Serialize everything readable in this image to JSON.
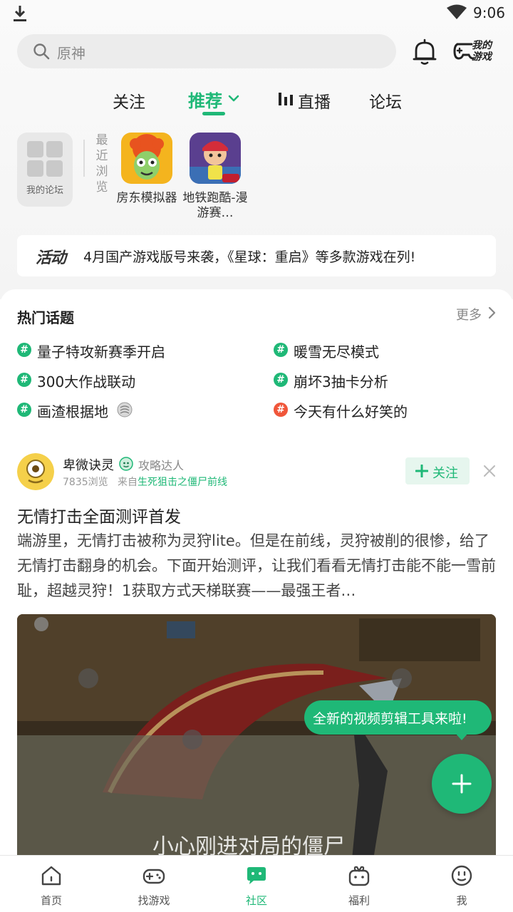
{
  "status_bar": {
    "time": "9:06"
  },
  "header": {
    "search_placeholder": "原神",
    "my_games_label": "我的游戏"
  },
  "tabs": [
    {
      "label": "关注"
    },
    {
      "label": "推荐"
    },
    {
      "label": "直播"
    },
    {
      "label": "论坛"
    }
  ],
  "recent": {
    "my_forum_label": "我的论坛",
    "recent_label": "最近浏览",
    "games": [
      {
        "name": "房东模拟器"
      },
      {
        "name": "地铁跑酷-漫游赛…"
      }
    ]
  },
  "activity": {
    "tag": "活动",
    "text": "4月国产游戏版号来袭，《星球：重启》等多款游戏在列!"
  },
  "hot_topics": {
    "title": "热门话题",
    "more_label": "更多",
    "items": [
      {
        "text": "量子特攻新赛季开启",
        "hot": false
      },
      {
        "text": "暖雪无尽模式",
        "hot": false
      },
      {
        "text": "300大作战联动",
        "hot": false
      },
      {
        "text": "崩坏3抽卡分析",
        "hot": false
      },
      {
        "text": "画渣根据地",
        "hot": false
      },
      {
        "text": "今天有什么好笑的",
        "hot": true
      }
    ]
  },
  "post": {
    "author": "卑微诀灵",
    "author_title": "攻略达人",
    "views": "7835浏览",
    "source_prefix": "来自",
    "source": "生死狙击之僵尸前线",
    "follow_label": "关注",
    "title": "无情打击全面测评首发",
    "body": "端游里，无情打击被称为灵狩lite。但是在前线，灵狩被削的很惨，给了无情打击翻身的机会。下面开始测评，让我们看看无情打击能不能一雪前耻，超越灵狩！1获取方式天梯联赛——最强王者…",
    "image_caption": "小心刚进对局的僵尸"
  },
  "tooltip": {
    "text": "全新的视频剪辑工具来啦!"
  },
  "bottom_nav": [
    {
      "label": "首页"
    },
    {
      "label": "找游戏"
    },
    {
      "label": "社区"
    },
    {
      "label": "福利"
    },
    {
      "label": "我"
    }
  ],
  "colors": {
    "accent": "#1fb877",
    "hot": "#f0563a"
  }
}
